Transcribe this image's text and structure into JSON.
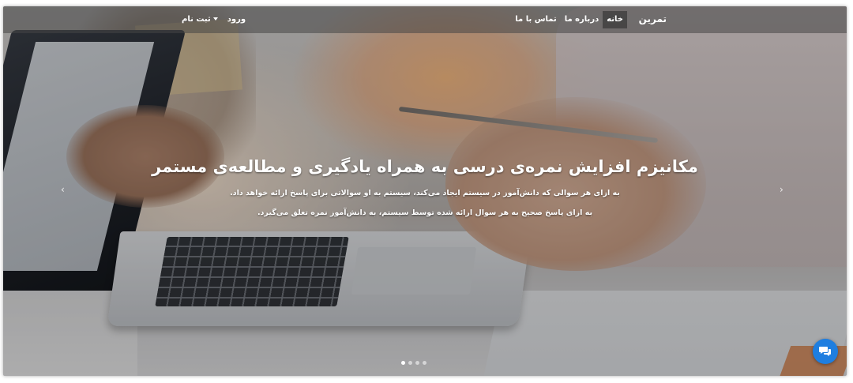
{
  "navbar": {
    "brand": "تمرین",
    "links": [
      {
        "label": "خانه",
        "active": true
      },
      {
        "label": "درباره ما",
        "active": false
      },
      {
        "label": "تماس با ما",
        "active": false
      }
    ],
    "login_label": "ورود",
    "register_label": "ثبت نام"
  },
  "carousel": {
    "title": "مکانیزم افزایش نمره‌ی درسی به همراه یادگیری و مطالعه‌ی مستمر",
    "line1": "به ازای هر سوالی که دانش‌آموز در سیستم ایجاد می‌کند، سیستم به او سوالاتی برای پاسخ ارائه خواهد داد.",
    "line2": "به ازای پاسخ صحیح به هر سوال ارائه شده توسط سیستم، به دانش‌آموز نمره تعلق می‌گیرد.",
    "prev_icon": "‹",
    "next_icon": "›",
    "slide_count": 4,
    "active_slide": 1
  },
  "chat_button": {
    "icon": "chat-bubbles-icon",
    "color": "#1e7ee0"
  },
  "colors": {
    "overlay": "rgba(0,0,0,0.28)",
    "navbar_bg": "rgba(70,70,70,0.55)",
    "text": "#ffffff"
  }
}
